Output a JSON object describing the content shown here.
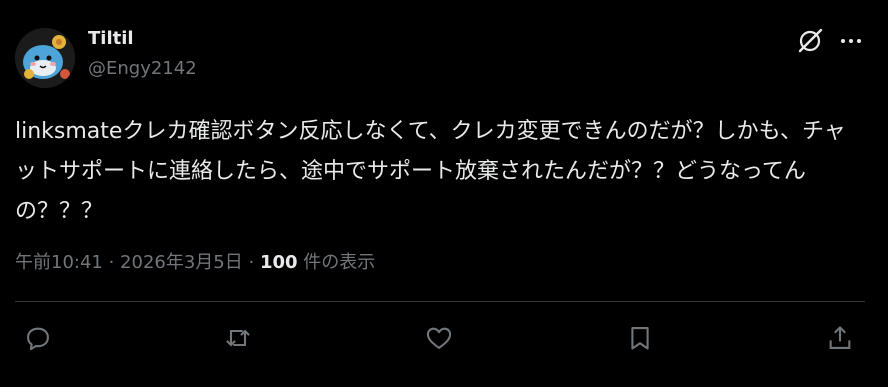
{
  "author": {
    "display_name": "Tiltil",
    "handle": "@Engy2142",
    "avatar_icon": "whale-avatar-icon"
  },
  "header_actions": {
    "grok_icon": "grok-icon",
    "more_icon": "more-options-icon"
  },
  "post": {
    "text": "linksmateクレカ確認ボタン反応しなくて、クレカ変更できんのだが？しかも、チャットサポートに連絡したら、途中でサポート放棄されたんだが？？どうなってんの？？？"
  },
  "meta": {
    "time": "午前10:41",
    "separator1": " · ",
    "date": "2026年3月5日",
    "separator2": " · ",
    "views_count": "100",
    "views_label": " 件の表示"
  },
  "actions": [
    {
      "icon": "reply-icon"
    },
    {
      "icon": "repost-icon"
    },
    {
      "icon": "like-icon"
    },
    {
      "icon": "bookmark-icon"
    },
    {
      "icon": "share-icon"
    }
  ],
  "colors": {
    "background": "#000000",
    "primary_text": "#e7e9ea",
    "secondary_text": "#71767b",
    "divider": "#2f3336"
  }
}
